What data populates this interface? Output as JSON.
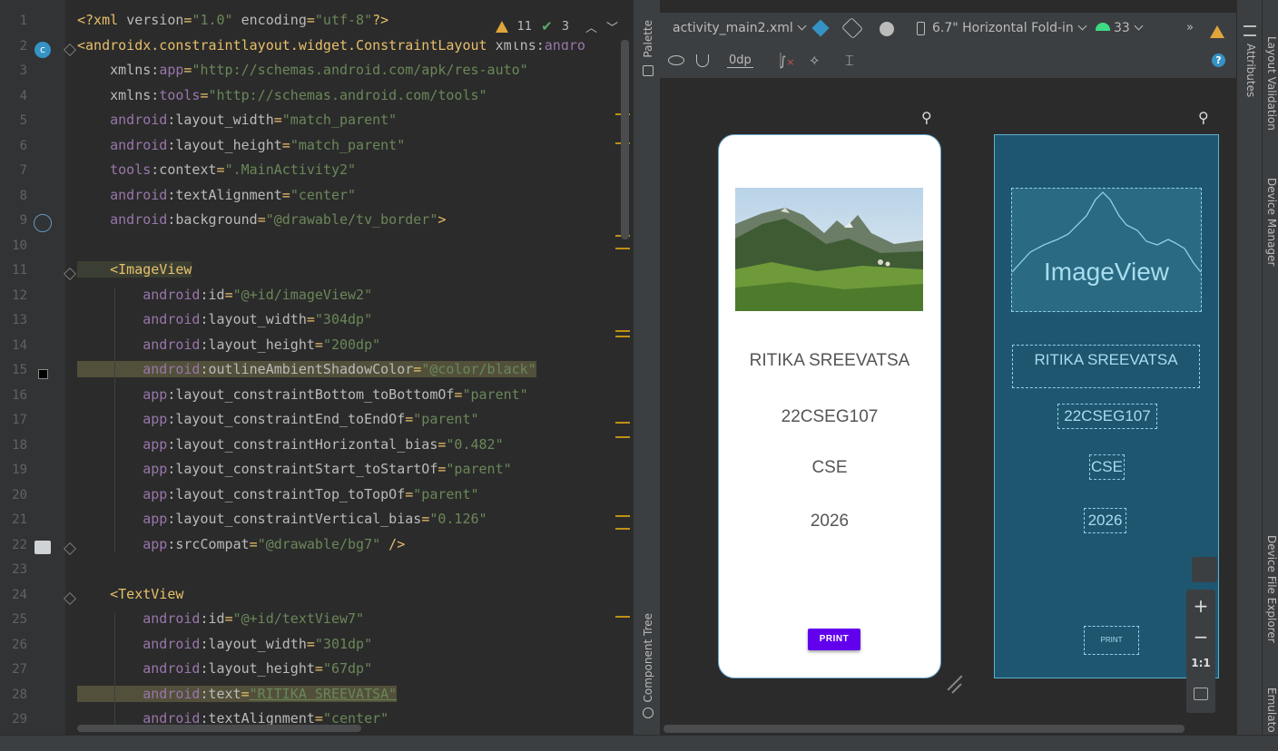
{
  "editor": {
    "inspection": {
      "warnings": "11",
      "weak_warnings": "3"
    },
    "lines": [
      {
        "n": "1",
        "parts": [
          [
            "t-pun",
            "<?xml "
          ],
          [
            "t-attr",
            "version"
          ],
          [
            "t-pun",
            "="
          ],
          [
            "t-val",
            "\"1.0\""
          ],
          [
            "t-attr",
            " encoding"
          ],
          [
            "t-pun",
            "="
          ],
          [
            "t-val",
            "\"utf-8\""
          ],
          [
            "t-pun",
            "?>"
          ]
        ]
      },
      {
        "n": "2",
        "parts": [
          [
            "t-tag",
            "<androidx.constraintlayout.widget.ConstraintLayout "
          ],
          [
            "t-attr",
            "xmlns:"
          ],
          [
            "t-ns",
            "andro"
          ]
        ]
      },
      {
        "n": "3",
        "parts": [
          [
            "t-attr",
            "    xmlns:"
          ],
          [
            "t-ns",
            "app"
          ],
          [
            "t-pun",
            "="
          ],
          [
            "t-val",
            "\"http://schemas.android.com/apk/res-auto\""
          ]
        ]
      },
      {
        "n": "4",
        "parts": [
          [
            "t-attr",
            "    xmlns:"
          ],
          [
            "t-ns",
            "tools"
          ],
          [
            "t-pun",
            "="
          ],
          [
            "t-val",
            "\"http://schemas.android.com/tools\""
          ]
        ]
      },
      {
        "n": "5",
        "parts": [
          [
            "t-ns",
            "    android"
          ],
          [
            "t-attr",
            ":layout_width"
          ],
          [
            "t-pun",
            "="
          ],
          [
            "t-val",
            "\"match_parent\""
          ]
        ]
      },
      {
        "n": "6",
        "parts": [
          [
            "t-ns",
            "    android"
          ],
          [
            "t-attr",
            ":layout_height"
          ],
          [
            "t-pun",
            "="
          ],
          [
            "t-val",
            "\"match_parent\""
          ]
        ]
      },
      {
        "n": "7",
        "parts": [
          [
            "t-ns",
            "    tools"
          ],
          [
            "t-attr",
            ":context"
          ],
          [
            "t-pun",
            "="
          ],
          [
            "t-val",
            "\".MainActivity2\""
          ]
        ]
      },
      {
        "n": "8",
        "parts": [
          [
            "t-ns",
            "    android"
          ],
          [
            "t-attr",
            ":textAlignment"
          ],
          [
            "t-pun",
            "="
          ],
          [
            "t-val",
            "\"center\""
          ]
        ]
      },
      {
        "n": "9",
        "parts": [
          [
            "t-ns",
            "    android"
          ],
          [
            "t-attr",
            ":background"
          ],
          [
            "t-pun",
            "="
          ],
          [
            "t-val",
            "\"@drawable/tv_border\""
          ],
          [
            "t-pun",
            ">"
          ]
        ]
      },
      {
        "n": "10",
        "parts": []
      },
      {
        "n": "11",
        "parts": [
          [
            "t-tag hl2",
            "    <ImageView"
          ]
        ]
      },
      {
        "n": "12",
        "parts": [
          [
            "t-ns",
            "        android"
          ],
          [
            "t-attr",
            ":id"
          ],
          [
            "t-pun",
            "="
          ],
          [
            "t-val",
            "\"@+id/imageView2\""
          ]
        ]
      },
      {
        "n": "13",
        "parts": [
          [
            "t-ns",
            "        android"
          ],
          [
            "t-attr",
            ":layout_width"
          ],
          [
            "t-pun",
            "="
          ],
          [
            "t-val",
            "\"304dp\""
          ]
        ]
      },
      {
        "n": "14",
        "parts": [
          [
            "t-ns",
            "        android"
          ],
          [
            "t-attr",
            ":layout_height"
          ],
          [
            "t-pun",
            "="
          ],
          [
            "t-val",
            "\"200dp\""
          ]
        ]
      },
      {
        "n": "15",
        "hl": true,
        "parts": [
          [
            "t-ns",
            "        android"
          ],
          [
            "t-attr",
            ":outlineAmbientShadowColor"
          ],
          [
            "t-pun",
            "="
          ],
          [
            "t-val",
            "\"@color/black\""
          ]
        ]
      },
      {
        "n": "16",
        "parts": [
          [
            "t-ns",
            "        app"
          ],
          [
            "t-attr",
            ":layout_constraintBottom_toBottomOf"
          ],
          [
            "t-pun",
            "="
          ],
          [
            "t-val",
            "\"parent\""
          ]
        ]
      },
      {
        "n": "17",
        "parts": [
          [
            "t-ns",
            "        app"
          ],
          [
            "t-attr",
            ":layout_constraintEnd_toEndOf"
          ],
          [
            "t-pun",
            "="
          ],
          [
            "t-val",
            "\"parent\""
          ]
        ]
      },
      {
        "n": "18",
        "parts": [
          [
            "t-ns",
            "        app"
          ],
          [
            "t-attr",
            ":layout_constraintHorizontal_bias"
          ],
          [
            "t-pun",
            "="
          ],
          [
            "t-val",
            "\"0.482\""
          ]
        ]
      },
      {
        "n": "19",
        "parts": [
          [
            "t-ns",
            "        app"
          ],
          [
            "t-attr",
            ":layout_constraintStart_toStartOf"
          ],
          [
            "t-pun",
            "="
          ],
          [
            "t-val",
            "\"parent\""
          ]
        ]
      },
      {
        "n": "20",
        "parts": [
          [
            "t-ns",
            "        app"
          ],
          [
            "t-attr",
            ":layout_constraintTop_toTopOf"
          ],
          [
            "t-pun",
            "="
          ],
          [
            "t-val",
            "\"parent\""
          ]
        ]
      },
      {
        "n": "21",
        "parts": [
          [
            "t-ns",
            "        app"
          ],
          [
            "t-attr",
            ":layout_constraintVertical_bias"
          ],
          [
            "t-pun",
            "="
          ],
          [
            "t-val",
            "\"0.126\""
          ]
        ]
      },
      {
        "n": "22",
        "parts": [
          [
            "t-ns",
            "        app"
          ],
          [
            "t-attr",
            ":srcCompat"
          ],
          [
            "t-pun",
            "="
          ],
          [
            "t-val",
            "\"@drawable/bg7\""
          ],
          [
            "t-pun",
            " />"
          ]
        ]
      },
      {
        "n": "23",
        "parts": []
      },
      {
        "n": "24",
        "parts": [
          [
            "t-tag",
            "    <TextView"
          ]
        ]
      },
      {
        "n": "25",
        "parts": [
          [
            "t-ns",
            "        android"
          ],
          [
            "t-attr",
            ":id"
          ],
          [
            "t-pun",
            "="
          ],
          [
            "t-val",
            "\"@+id/textView7\""
          ]
        ]
      },
      {
        "n": "26",
        "parts": [
          [
            "t-ns",
            "        android"
          ],
          [
            "t-attr",
            ":layout_width"
          ],
          [
            "t-pun",
            "="
          ],
          [
            "t-val",
            "\"301dp\""
          ]
        ]
      },
      {
        "n": "27",
        "parts": [
          [
            "t-ns",
            "        android"
          ],
          [
            "t-attr",
            ":layout_height"
          ],
          [
            "t-pun",
            "="
          ],
          [
            "t-val",
            "\"67dp\""
          ]
        ]
      },
      {
        "n": "28",
        "hl": true,
        "parts": [
          [
            "t-ns",
            "        android"
          ],
          [
            "t-attr",
            ":text"
          ],
          [
            "t-pun",
            "="
          ],
          [
            "t-val under",
            "\"RITIKA SREEVATSA\""
          ]
        ]
      },
      {
        "n": "29",
        "parts": [
          [
            "t-ns",
            "        android"
          ],
          [
            "t-attr",
            ":textAlignment"
          ],
          [
            "t-pun",
            "="
          ],
          [
            "t-val",
            "\"center\""
          ]
        ]
      }
    ]
  },
  "side_panels": {
    "palette": "Palette",
    "component_tree": "Component Tree",
    "attributes": "Attributes",
    "layout_validation": "Layout Validation",
    "device_manager": "Device Manager",
    "device_file_explorer": "Device File Explorer",
    "emulator": "Emulato"
  },
  "design_toolbar": {
    "file": "activity_main2.xml",
    "device": "6.7\" Horizontal Fold-in",
    "api": "33",
    "margin": "0dp"
  },
  "preview": {
    "name": "RITIKA SREEVATSA",
    "roll": "22CSEG107",
    "dept": "CSE",
    "year": "2026",
    "button": "PRINT"
  },
  "blueprint": {
    "image_label": "ImageView",
    "name": "RITIKA SREEVATSA",
    "roll": "22CSEG107",
    "dept": "CSE",
    "year": "2026",
    "button": "PRINT"
  },
  "zoom": {
    "in": "+",
    "out": "−",
    "fit": "1:1"
  }
}
